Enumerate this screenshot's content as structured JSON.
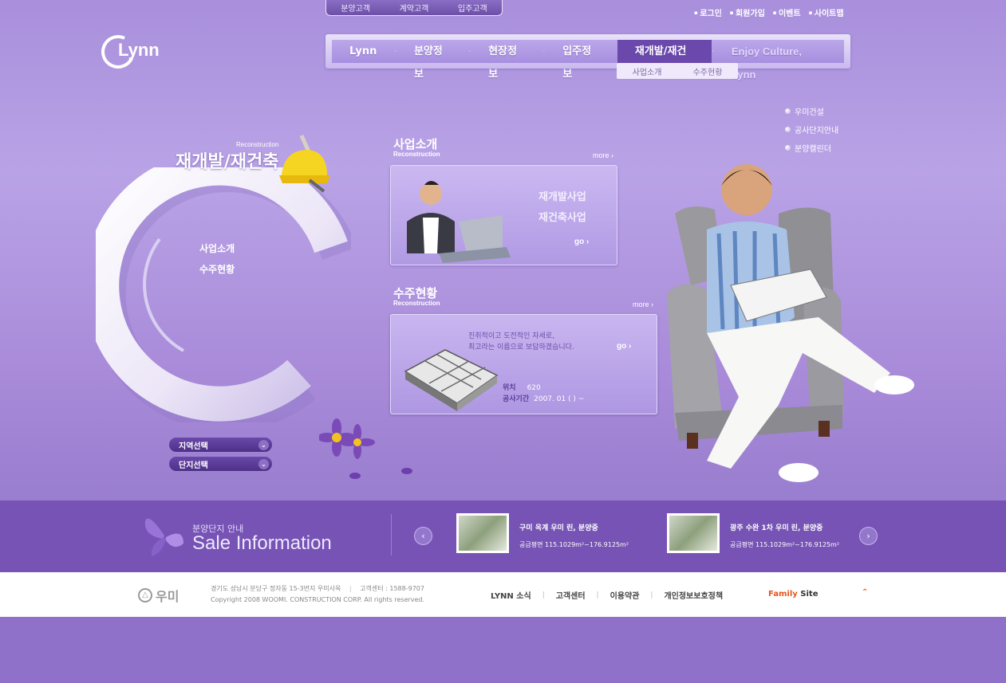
{
  "top_tabs": [
    "분양고객",
    "계약고객",
    "입주고객"
  ],
  "util_links": [
    "로그인",
    "회원가입",
    "이벤트",
    "사이트맵"
  ],
  "logo": "Lynn",
  "nav": {
    "items": [
      "Lynn",
      "분양정보",
      "현장정보",
      "입주정보",
      "재개발/재건축",
      "Enjoy Culture, Lynn"
    ],
    "active": "재개발/재건축",
    "sub": [
      "사업소개",
      "수주현황"
    ]
  },
  "quick_links": [
    "우미건설",
    "공사단지안내",
    "분양캘린더"
  ],
  "hero": {
    "small": "Reconstruction",
    "title": "재개발/재건축",
    "links": [
      "사업소개",
      "수주현황"
    ],
    "selects": [
      "지역선택",
      "단지선택"
    ]
  },
  "section1": {
    "title": "사업소개",
    "sub": "Reconstruction",
    "more": "more ›",
    "items": [
      "재개발사업",
      "재건축사업"
    ],
    "go": "go ›"
  },
  "section2": {
    "title": "수주현황",
    "sub": "Reconstruction",
    "more": "more ›",
    "text1": "진취적이고 도전적인 자세로,",
    "text2": "최고라는 이름으로 보답하겠습니다.",
    "go": "go ›",
    "loc_label": "위치",
    "loc_value": "620",
    "period_label": "공사기간",
    "period_value": "2007. 01 ( ) ~"
  },
  "sale": {
    "korean": "분양단지 안내",
    "english": "Sale Information",
    "items": [
      {
        "title": "구미 옥계 우미 린, 분양중",
        "detail": "공급평면 115.1029m²~176.9125m²"
      },
      {
        "title": "광주 수완 1차 우미 린, 분양중",
        "detail": "공급평면 115.1029m²~176.9125m²"
      }
    ]
  },
  "footer": {
    "brand": "우미",
    "address": "경기도 성남시 분당구 정자동 15-3번지 우미사옥",
    "center": "고객센터 : 1588-9707",
    "copyright": "Copyright 2008  WOOMI. CONSTRUCTION CORP. All rights reserved.",
    "links": [
      "LYNN 소식",
      "고객센터",
      "이용약관",
      "개인정보보호정책"
    ],
    "family_a": "Family",
    "family_b": "Site"
  },
  "colors": {
    "accent": "#6b48ac",
    "family": "#e8541e"
  }
}
